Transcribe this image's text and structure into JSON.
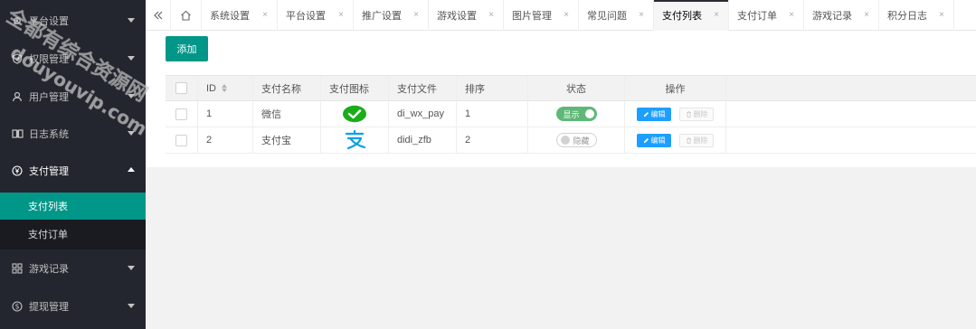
{
  "sidebar": {
    "items": [
      {
        "label": "平台设置",
        "icon": "gear-icon"
      },
      {
        "label": "权限管理",
        "icon": "shield-icon"
      },
      {
        "label": "用户管理",
        "icon": "user-icon"
      },
      {
        "label": "日志系统",
        "icon": "book-icon"
      },
      {
        "label": "支付管理",
        "icon": "yen-icon"
      },
      {
        "label": "游戏记录",
        "icon": "grid-icon"
      },
      {
        "label": "提现管理",
        "icon": "dollar-icon"
      }
    ],
    "sub_items": [
      {
        "label": "支付列表",
        "active": true
      },
      {
        "label": "支付订单",
        "active": false
      }
    ]
  },
  "tabs": {
    "items": [
      {
        "label": "系统设置"
      },
      {
        "label": "平台设置"
      },
      {
        "label": "推广设置"
      },
      {
        "label": "游戏设置"
      },
      {
        "label": "图片管理"
      },
      {
        "label": "常见问题"
      },
      {
        "label": "支付列表",
        "active": true
      },
      {
        "label": "支付订单"
      },
      {
        "label": "游戏记录"
      },
      {
        "label": "积分日志"
      }
    ],
    "close_glyph": "×"
  },
  "toolbar": {
    "add_label": "添加"
  },
  "table": {
    "headers": [
      "ID",
      "支付名称",
      "支付图标",
      "支付文件",
      "排序",
      "状态",
      "操作"
    ],
    "rows": [
      {
        "id": "1",
        "name": "微信",
        "icon": "wechat-icon",
        "file": "di_wx_pay",
        "sort": "1",
        "status": "显示",
        "status_on": true
      },
      {
        "id": "2",
        "name": "支付宝",
        "icon": "alipay-icon",
        "file": "didi_zfb",
        "sort": "2",
        "status": "隐藏",
        "status_on": false
      }
    ],
    "edit_label": "编辑",
    "delete_label": "删除"
  },
  "watermark": {
    "line1": "全都有综合资源网",
    "line2": "douyouvip.com"
  },
  "colors": {
    "sidebar": "#23262e",
    "accent": "#009688",
    "edit": "#1e9fff",
    "switch_on": "#5fb878"
  }
}
